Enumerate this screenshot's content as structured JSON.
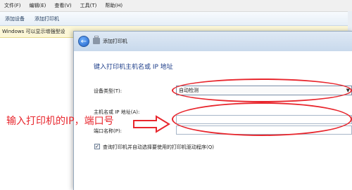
{
  "menu": [
    "文件(F)",
    "编辑(E)",
    "查看(V)",
    "工具(T)",
    "帮助(H)"
  ],
  "toolbar": [
    "添加设备",
    "添加打印机"
  ],
  "infobar": "Windows 可以显示增强型设",
  "dialog": {
    "title": "添加打印机",
    "heading": "键入打印机主机名或 IP 地址",
    "device_type_label": "设备类型(T):",
    "device_type_value": "自动检测",
    "host_label": "主机名或 IP 地址(A):",
    "host_value": "",
    "port_label": "端口名称(P):",
    "port_value": "",
    "checkbox_label": "查询打印机并自动选择要使用的打印机驱动程序(Q)",
    "checkbox_checked": true
  },
  "annotation": {
    "text": "输入打印机的IP，端口号",
    "color": "#e8262d"
  },
  "icons": {
    "back": "back-arrow-icon",
    "printer": "printer-icon",
    "dropdown": "chevron-down-icon",
    "check": "checkmark-icon"
  }
}
